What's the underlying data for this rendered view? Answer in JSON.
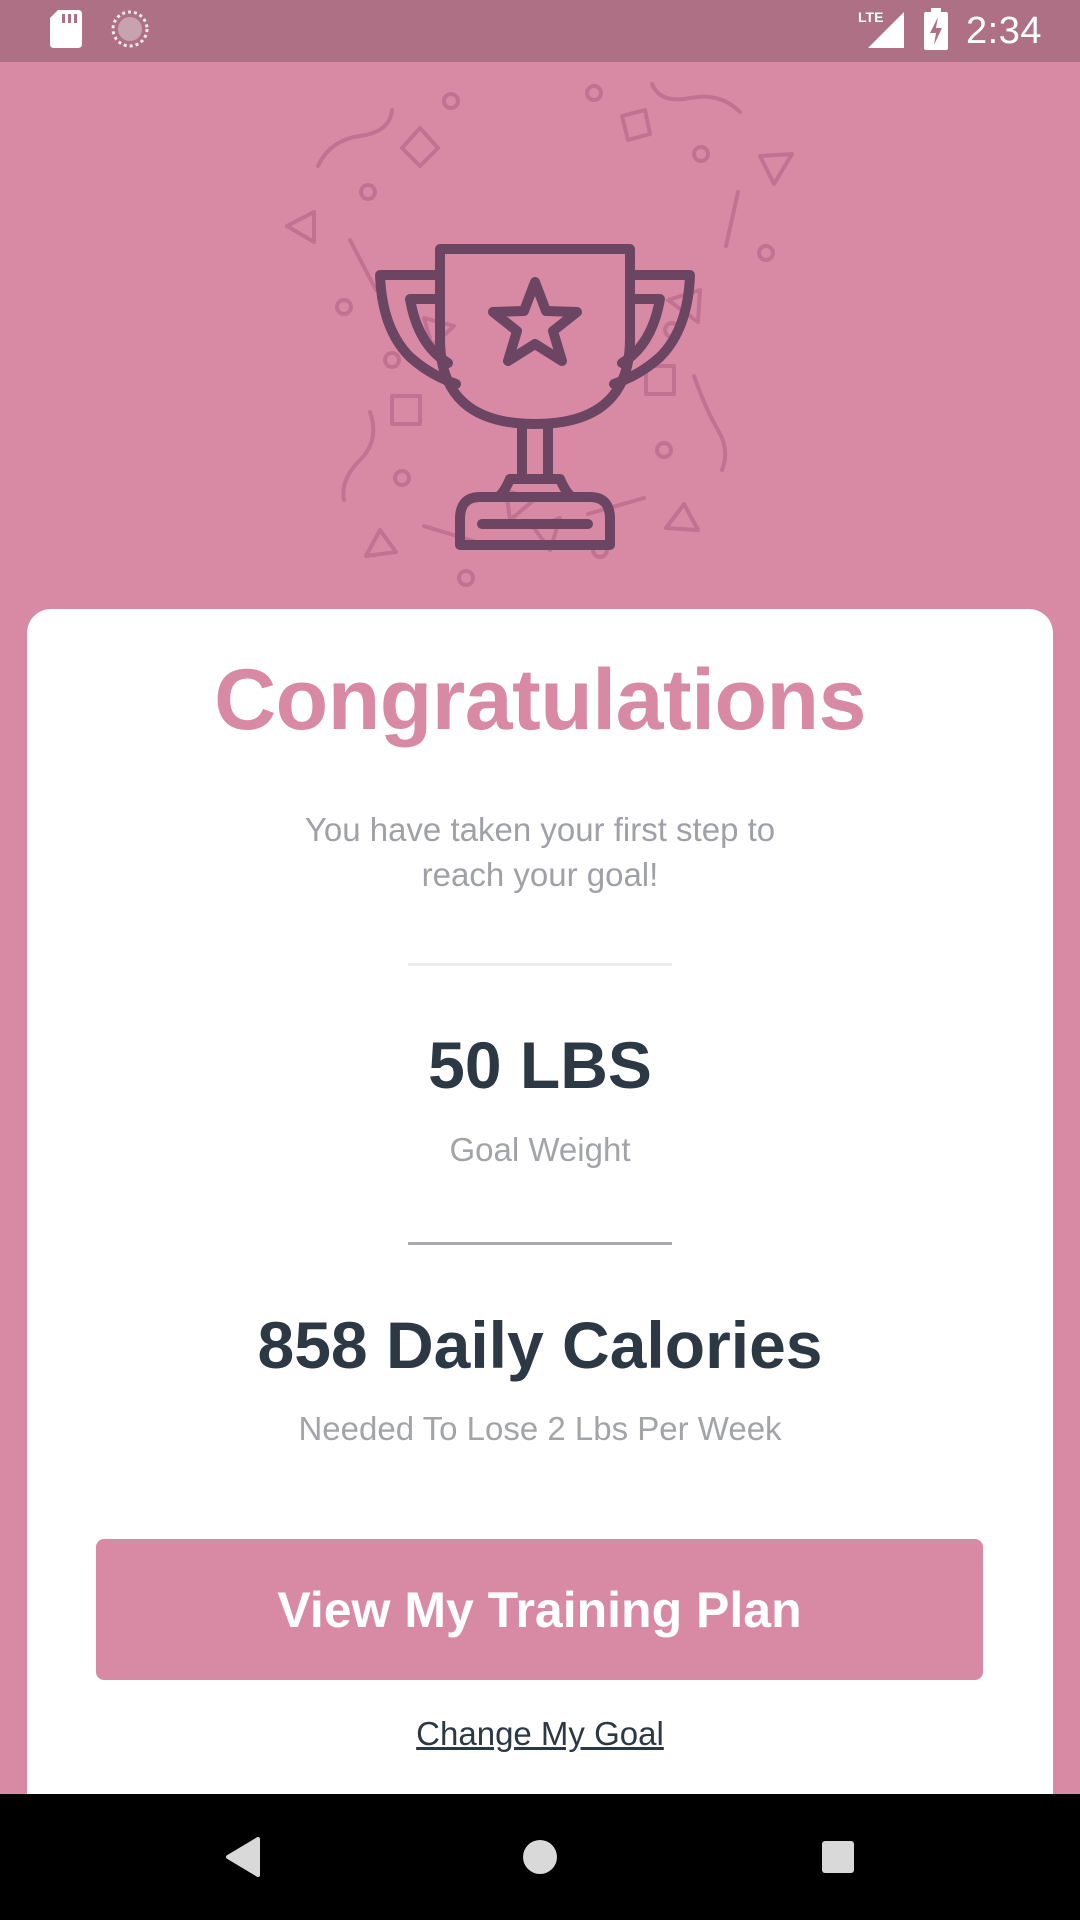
{
  "status_bar": {
    "time": "2:34",
    "network_label": "LTE",
    "icons": [
      "sd-card-icon",
      "sync-icon",
      "lte-signal-icon",
      "battery-charging-icon"
    ]
  },
  "card": {
    "title": "Congratulations",
    "subtitle_line1": "You have taken your first step to",
    "subtitle_line2": "reach your goal!",
    "goal_value": "50 LBS",
    "goal_label": "Goal Weight",
    "calories_value": "858 Daily Calories",
    "calories_label": "Needed To Lose 2 Lbs Per Week",
    "primary_button_label": "View My Training Plan",
    "secondary_link_label": "Change My Goal"
  },
  "colors": {
    "brand_pink": "#d88aa4",
    "status_bar": "#ad7085",
    "trophy_stroke": "#6b4562",
    "dark_text": "#2d3845",
    "muted_text": "#a2a4a8"
  },
  "hero": {
    "icon": "trophy-icon"
  },
  "nav": {
    "icons": [
      "back-icon",
      "home-icon",
      "recents-icon"
    ]
  }
}
